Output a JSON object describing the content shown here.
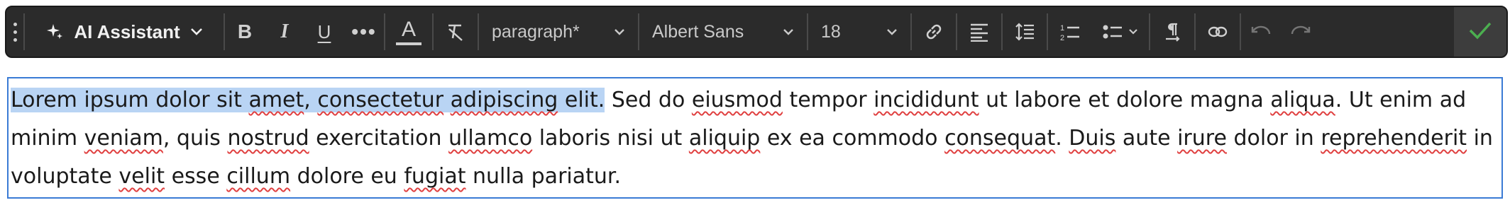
{
  "toolbar": {
    "ai_label": "AI Assistant",
    "bold_label": "B",
    "italic_label": "I",
    "underline_label": "U",
    "more_label": "•••",
    "text_color_label": "A",
    "paragraph_style": "paragraph*",
    "font_family": "Albert Sans",
    "font_size": "18",
    "icons": [
      "drag-handle-icon",
      "sparkle-icon",
      "chevron-down-icon",
      "clear-format-icon",
      "link-icon",
      "align-left-icon",
      "line-height-icon",
      "ordered-list-icon",
      "bullet-list-icon",
      "paragraph-direction-icon",
      "unlink-icon",
      "undo-icon",
      "redo-icon",
      "checkmark-icon"
    ],
    "colors": {
      "background": "#2b2b2b",
      "icon": "#d7d7d7",
      "confirm": "#4caf50"
    }
  },
  "editor": {
    "selected_text": "Lorem ipsum dolor sit amet, consectetur adipiscing elit.",
    "segments": [
      {
        "t": "Lorem ipsum dolor sit ",
        "sel": true
      },
      {
        "t": "amet",
        "sel": true,
        "sp": true
      },
      {
        "t": ", ",
        "sel": true
      },
      {
        "t": "consectetur",
        "sel": true,
        "sp": true
      },
      {
        "t": " ",
        "sel": true
      },
      {
        "t": "adipiscing",
        "sel": true,
        "sp": true
      },
      {
        "t": " elit.",
        "sel": true
      },
      {
        "t": " Sed do "
      },
      {
        "t": "eiusmod",
        "sp": true
      },
      {
        "t": " tempor "
      },
      {
        "t": "incididunt",
        "sp": true
      },
      {
        "t": " ut labore et dolore magna "
      },
      {
        "t": "aliqua",
        "sp": true
      },
      {
        "t": ". Ut enim ad minim "
      },
      {
        "t": "veniam",
        "sp": true
      },
      {
        "t": ", quis "
      },
      {
        "t": "nostrud",
        "sp": true
      },
      {
        "t": " exercitation "
      },
      {
        "t": "ullamco",
        "sp": true
      },
      {
        "t": " laboris nisi ut "
      },
      {
        "t": "aliquip",
        "sp": true
      },
      {
        "t": " ex ea commodo "
      },
      {
        "t": "consequat",
        "sp": true
      },
      {
        "t": ". "
      },
      {
        "t": "Duis",
        "sp": true
      },
      {
        "t": " aute "
      },
      {
        "t": "irure",
        "sp": true
      },
      {
        "t": " dolor in "
      },
      {
        "t": "reprehenderit",
        "sp": true
      },
      {
        "t": " in voluptate "
      },
      {
        "t": "velit",
        "sp": true
      },
      {
        "t": " esse "
      },
      {
        "t": "cillum",
        "sp": true
      },
      {
        "t": " dolore eu "
      },
      {
        "t": "fugiat",
        "sp": true
      },
      {
        "t": " nulla pariatur."
      }
    ],
    "colors": {
      "selection": "#b9d4f4",
      "border": "#3a7bd5",
      "spellcheck": "#e04040"
    }
  }
}
